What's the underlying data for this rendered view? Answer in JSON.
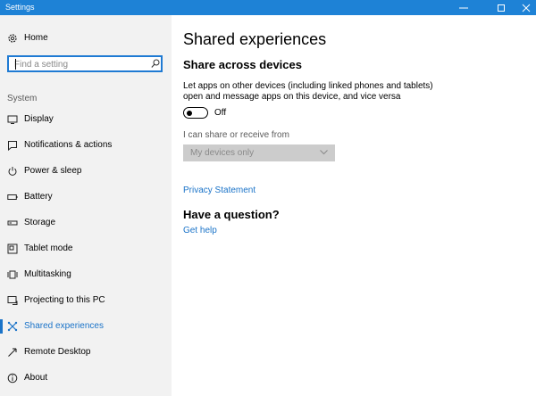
{
  "window": {
    "title": "Settings",
    "accent_color": "#1e82d6"
  },
  "sidebar": {
    "home_label": "Home",
    "search": {
      "placeholder": "Find a setting",
      "icon": "search-icon"
    },
    "section_label": "System",
    "items": [
      {
        "label": "Display",
        "icon": "monitor-icon"
      },
      {
        "label": "Notifications & actions",
        "icon": "notification-icon"
      },
      {
        "label": "Power & sleep",
        "icon": "power-icon"
      },
      {
        "label": "Battery",
        "icon": "battery-icon"
      },
      {
        "label": "Storage",
        "icon": "storage-icon"
      },
      {
        "label": "Tablet mode",
        "icon": "tablet-mode-icon"
      },
      {
        "label": "Multitasking",
        "icon": "multitasking-icon"
      },
      {
        "label": "Projecting to this PC",
        "icon": "projecting-icon"
      },
      {
        "label": "Shared experiences",
        "icon": "shared-experiences-icon",
        "selected": true
      },
      {
        "label": "Remote Desktop",
        "icon": "remote-desktop-icon"
      },
      {
        "label": "About",
        "icon": "info-icon"
      }
    ],
    "selected_color": "#1a73c8"
  },
  "main": {
    "title": "Shared experiences",
    "subheading": "Share across devices",
    "description": "Let apps on other devices (including linked phones and tablets) open and message apps on this device, and vice versa",
    "toggle": {
      "state_label": "Off",
      "on": false
    },
    "share_label": "I can share or receive from",
    "dropdown": {
      "selected": "My devices only",
      "disabled": true
    },
    "privacy_link": "Privacy Statement",
    "question_heading": "Have a question?",
    "help_link": "Get help",
    "link_color": "#1a73c8"
  }
}
